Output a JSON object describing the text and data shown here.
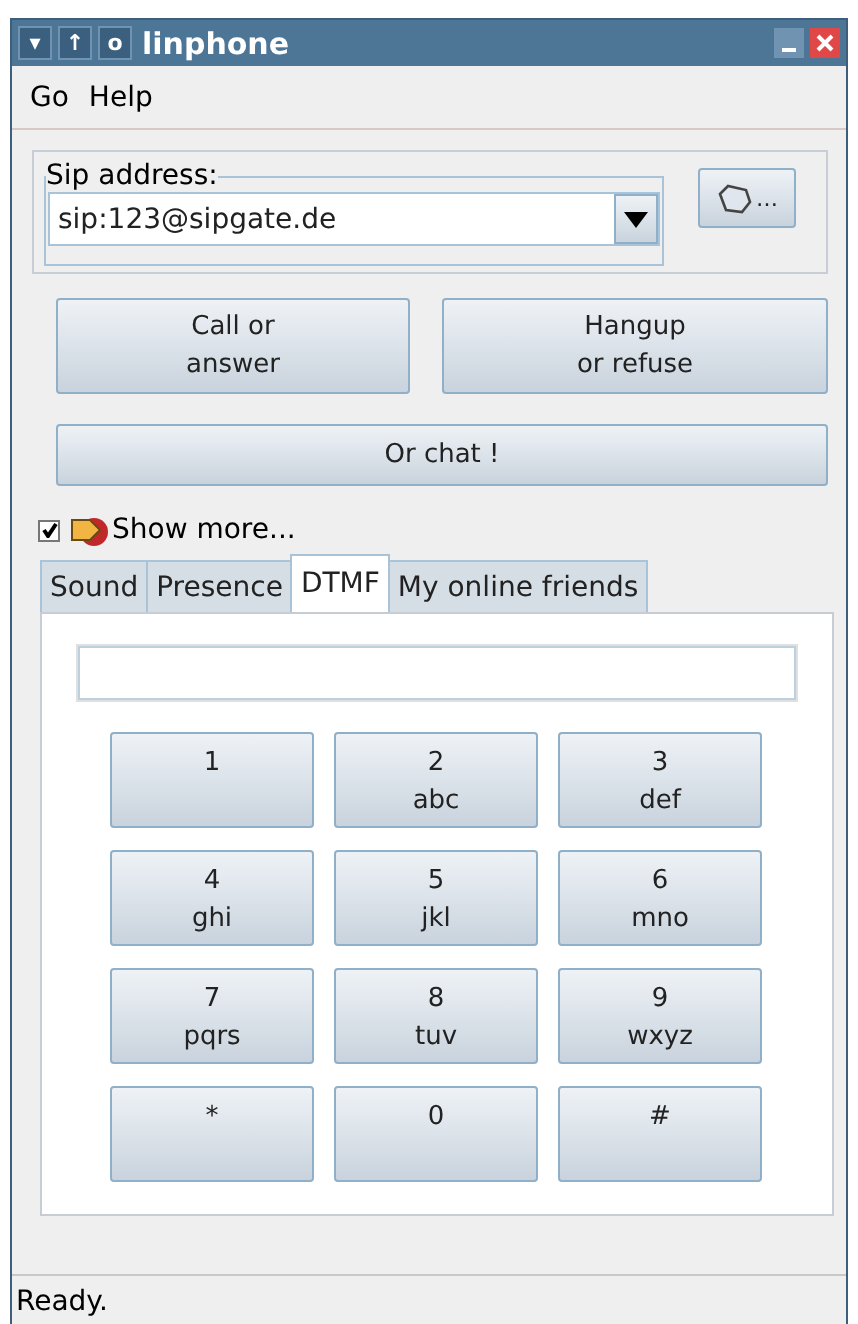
{
  "window": {
    "title": "linphone",
    "title_buttons": [
      "▾",
      "↑",
      "o"
    ]
  },
  "menu": [
    "Go",
    "Help"
  ],
  "sip": {
    "label": "Sip address:",
    "value": "sip:123@sipgate.de",
    "button": "…"
  },
  "actions": [
    "Call or\nanswer",
    "Hangup\nor refuse"
  ],
  "chat_button": "Or chat !",
  "show_more": {
    "label": "Show more...",
    "checked": true
  },
  "tabs": [
    {
      "label": "Sound",
      "selected": false
    },
    {
      "label": "Presence",
      "selected": false
    },
    {
      "label": "DTMF",
      "selected": true
    },
    {
      "label": "My online friends",
      "selected": false
    }
  ],
  "dtmf": {
    "keys": [
      {
        "digit": "1"
      },
      {
        "digit": "2",
        "letters": "abc"
      },
      {
        "digit": "3",
        "letters": "def"
      },
      {
        "digit": "4",
        "letters": "ghi"
      },
      {
        "digit": "5",
        "letters": "jkl"
      },
      {
        "digit": "6",
        "letters": "mno"
      },
      {
        "digit": "7",
        "letters": "pqrs"
      },
      {
        "digit": "8",
        "letters": "tuv"
      },
      {
        "digit": "9",
        "letters": "wxyz"
      },
      {
        "digit": "*"
      },
      {
        "digit": "0"
      },
      {
        "digit": "#"
      }
    ]
  },
  "status_bar": "Ready."
}
